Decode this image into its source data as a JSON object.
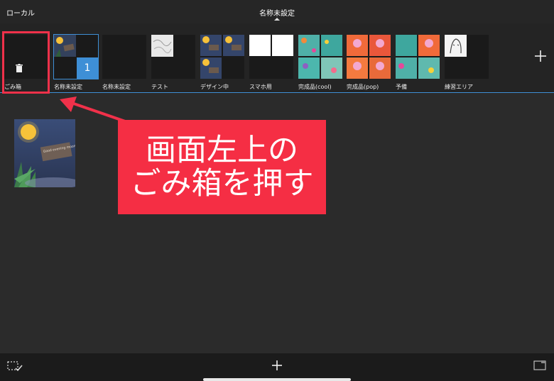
{
  "topbar": {
    "left_label": "ローカル",
    "title": "名称未設定"
  },
  "folders": [
    {
      "label": "ごみ箱"
    },
    {
      "label": "名称未設定",
      "badge": "1"
    },
    {
      "label": "名称未設定"
    },
    {
      "label": "テスト"
    },
    {
      "label": "デザイン中"
    },
    {
      "label": "スマホ用"
    },
    {
      "label": "完成品(cool)"
    },
    {
      "label": "完成品(pop)"
    },
    {
      "label": "予備"
    },
    {
      "label": "練習エリア"
    }
  ],
  "document": {
    "caption_text": "Good evening moon"
  },
  "callout": {
    "line1": "画面左上の",
    "line2": "ごみ箱を押す"
  },
  "icons": {
    "trash": "trash-icon",
    "add_folder": "plus-icon",
    "select": "select-icon",
    "add_canvas": "plus-icon",
    "layout": "layout-icon"
  },
  "colors": {
    "accent": "#3e8fd6",
    "highlight": "#f0314a",
    "callout_bg": "#f52e44"
  }
}
